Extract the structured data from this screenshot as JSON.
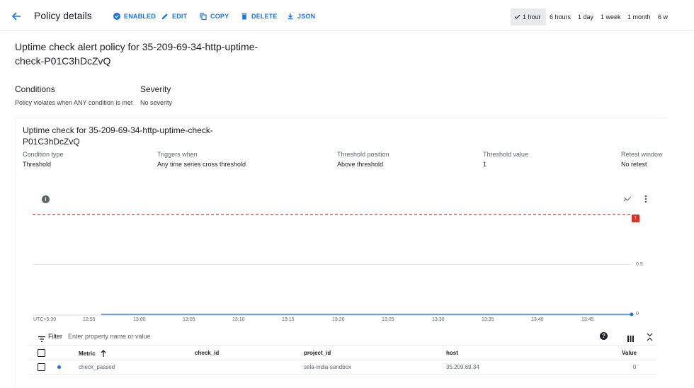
{
  "toolbar": {
    "title": "Policy details",
    "enabled_label": "ENABLED",
    "edit_label": "EDIT",
    "copy_label": "COPY",
    "delete_label": "DELETE",
    "json_label": "JSON",
    "accent": "#1a73e8"
  },
  "time_ranges": [
    "1 hour",
    "6 hours",
    "1 day",
    "1 week",
    "1 month",
    "6 w"
  ],
  "selected_range": "1 hour",
  "policy": {
    "title": "Uptime check alert policy for 35-209-69-34-http-uptime-check-P01C3hDcZvQ",
    "conditions_heading": "Conditions",
    "conditions_value": "Policy violates when ANY condition is met",
    "severity_heading": "Severity",
    "severity_value": "No severity"
  },
  "condition": {
    "title": "Uptime check for 35-209-69-34-http-uptime-check-P01C3hDcZvQ",
    "fields": [
      {
        "label": "Condition type",
        "value": "Threshold"
      },
      {
        "label": "Triggers when",
        "value": "Any time series cross threshold"
      },
      {
        "label": "Threshold position",
        "value": "Above threshold"
      },
      {
        "label": "Threshold value",
        "value": "1"
      },
      {
        "label": "Retest window",
        "value": "No retest"
      }
    ]
  },
  "chart": {
    "info_icon": "info-icon",
    "threshold_badge": "1",
    "threshold_color": "#d93025",
    "series_color": "#1a73e8",
    "x_ticks": [
      "UTC+5:30",
      "12:55",
      "13:00",
      "13:05",
      "13:10",
      "13:15",
      "13:20",
      "13:25",
      "13:30",
      "13:35",
      "13:40",
      "13:45"
    ],
    "y_ticks": [
      "0.5",
      "0"
    ]
  },
  "chart_data": {
    "type": "line",
    "x": [
      "12:55",
      "13:00",
      "13:05",
      "13:10",
      "13:15",
      "13:20",
      "13:25",
      "13:30",
      "13:35",
      "13:40",
      "13:45"
    ],
    "series": [
      {
        "name": "check_passed",
        "values": [
          0,
          0,
          0,
          0,
          0,
          0,
          0,
          0,
          0,
          0,
          0
        ]
      }
    ],
    "threshold": 1,
    "ylim": [
      0,
      1
    ],
    "grid": true
  },
  "filter": {
    "label": "Filter",
    "placeholder": "Enter property name or value"
  },
  "table": {
    "headers": {
      "metric": "Metric",
      "check_id": "check_id",
      "project_id": "project_id",
      "host": "host",
      "value": "Value"
    },
    "rows": [
      {
        "metric": "check_passed",
        "check_id": "",
        "project_id": "sela-india-sandbox",
        "host": "35.209.69.34",
        "value": "0"
      }
    ]
  }
}
